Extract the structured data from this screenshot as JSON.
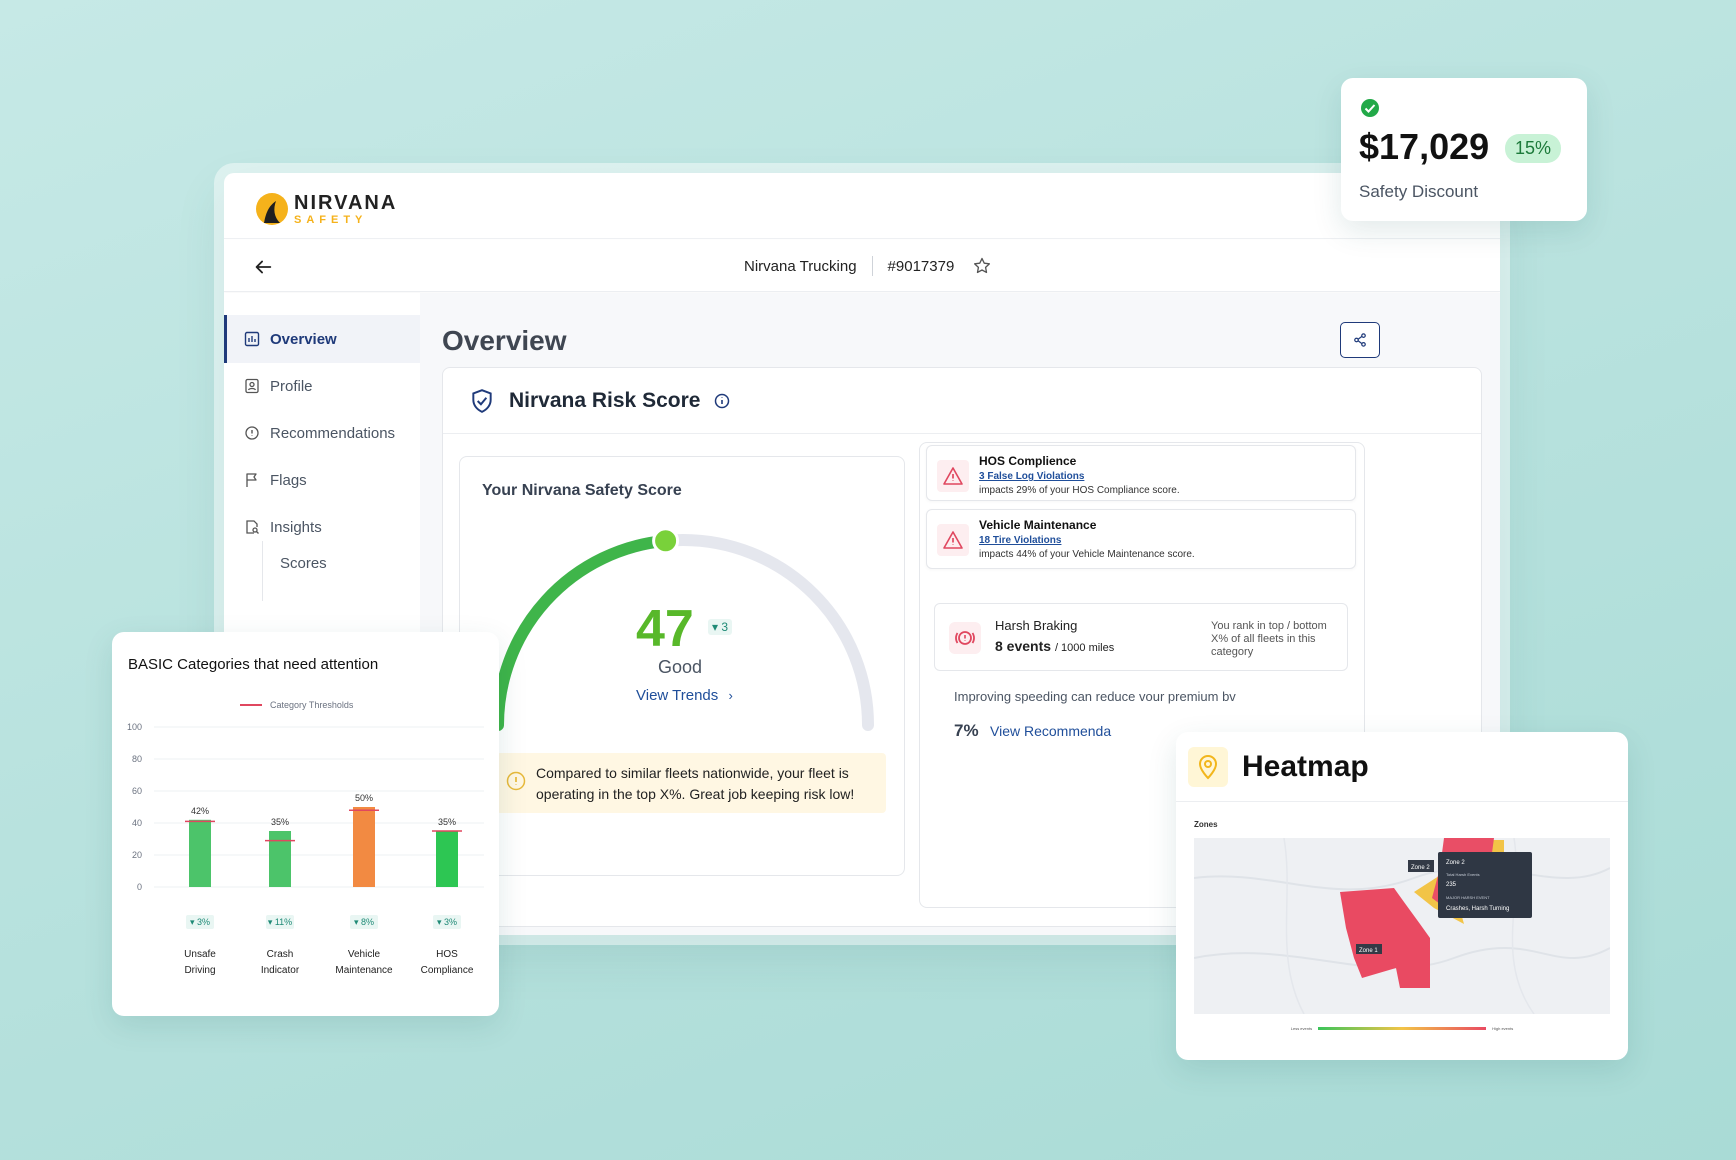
{
  "brand": {
    "name": "NIRVANA",
    "sub": "SAFETY"
  },
  "header": {
    "company": "Nirvana Trucking",
    "id": "#9017379"
  },
  "sidebar": {
    "items": [
      {
        "label": "Overview"
      },
      {
        "label": "Profile"
      },
      {
        "label": "Recommendations"
      },
      {
        "label": "Flags"
      },
      {
        "label": "Insights"
      }
    ],
    "sub_items": [
      {
        "label": "Scores"
      }
    ]
  },
  "page": {
    "title": "Overview"
  },
  "risk": {
    "title": "Nirvana Risk Score",
    "score_title": "Your Nirvana Safety Score",
    "score": "47",
    "delta": "▾ 3",
    "rating": "Good",
    "gauge_fraction": 0.47,
    "view_trends": "View Trends",
    "note": "Compared to similar fleets nationwide, your fleet is operating in the top X%. Great job keeping risk low!"
  },
  "alerts": [
    {
      "title": "HOS Complience",
      "link": "3 False Log Violations",
      "detail": "impacts 29% of your HOS Compliance score."
    },
    {
      "title": "Vehicle Maintenance",
      "link": "18 Tire Violations",
      "detail": "impacts 44% of your Vehicle Maintenance score."
    }
  ],
  "harsh": {
    "title": "Harsh Braking",
    "events": "8 events",
    "unit": "/ 1000 miles",
    "rank": "You rank in top / bottom X% of all fleets in this category"
  },
  "speeding": {
    "text": "Improving speeding can reduce vour premium bv",
    "pct": "7%",
    "link": "View Recommenda"
  },
  "discount": {
    "amount": "$17,029",
    "pct": "15%",
    "label": "Safety Discount"
  },
  "basic": {
    "title": "BASIC Categories that need attention",
    "legend": "Category Thresholds"
  },
  "chart_data": {
    "type": "bar",
    "title": "BASIC Categories that need attention",
    "categories": [
      "Unsafe Driving",
      "Crash Indicator",
      "Vehicle Maintenance",
      "HOS Compliance"
    ],
    "values": [
      42,
      35,
      50,
      35
    ],
    "value_labels": [
      "42%",
      "35%",
      "50%",
      "35%"
    ],
    "thresholds": [
      41,
      29,
      48,
      35
    ],
    "changes": [
      "▾ 3%",
      "▾ 11%",
      "▾ 8%",
      "▾ 3%"
    ],
    "bar_colors": [
      "#4cc46a",
      "#4cc46a",
      "#f28a42",
      "#2dc653"
    ],
    "ylim": [
      0,
      100
    ],
    "yticks": [
      0,
      20,
      40,
      60,
      80,
      100
    ],
    "legend": [
      "Category Thresholds"
    ]
  },
  "heatmap": {
    "title": "Heatmap",
    "zones_label": "Zones",
    "zone1": "Zone 1",
    "zone2": "Zone 2",
    "tooltip_zone": "Zone 2",
    "tooltip_caption": "Total Harsh Events",
    "tooltip_value": "235",
    "tooltip_caption2": "MAJOR HARSH EVENT",
    "tooltip_value2": "Crashes, Harsh Turning",
    "scale_low": "Less events",
    "scale_high": "High events"
  }
}
